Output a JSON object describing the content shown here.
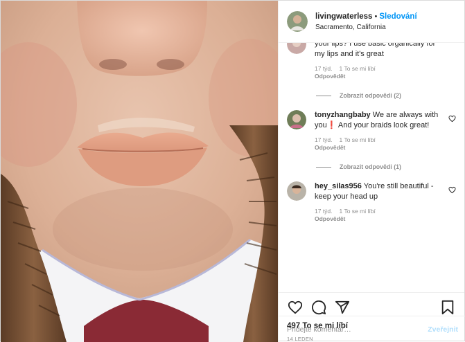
{
  "header": {
    "username": "livingwaterless",
    "separator": "•",
    "follow_label": "Sledování",
    "location": "Sacramento, California"
  },
  "comments": [
    {
      "username": "",
      "text": "your lips? I use basic organically for my lips and it's great",
      "time": "17 týd.",
      "likes": "1 To se mi líbí",
      "reply": "Odpovědět",
      "view_replies": "Zobrazit odpovědi (2)"
    },
    {
      "username": "tonyzhangbaby",
      "text": "We are always with you❗️ And your braids look great!",
      "time": "17 týd.",
      "likes": "1 To se mi líbí",
      "reply": "Odpovědět",
      "view_replies": "Zobrazit odpovědi (1)"
    },
    {
      "username": "hey_silas956",
      "text": "You're still beautiful - keep your head up",
      "time": "17 týd.",
      "likes": "1 To se mi líbí",
      "reply": "Odpovědět",
      "view_replies": ""
    }
  ],
  "actions": {
    "like_icon": "heart-icon",
    "comment_icon": "comment-icon",
    "share_icon": "share-icon",
    "save_icon": "bookmark-icon"
  },
  "likes_count": "497 To se mi líbí",
  "date": "14 LEDEN",
  "add_comment": {
    "placeholder": "Přidejte komentář…",
    "publish_label": "Zveřejnit"
  },
  "colors": {
    "accent": "#0095f6",
    "publish_disabled": "#b2dffc",
    "muted": "#8e8e8e"
  }
}
